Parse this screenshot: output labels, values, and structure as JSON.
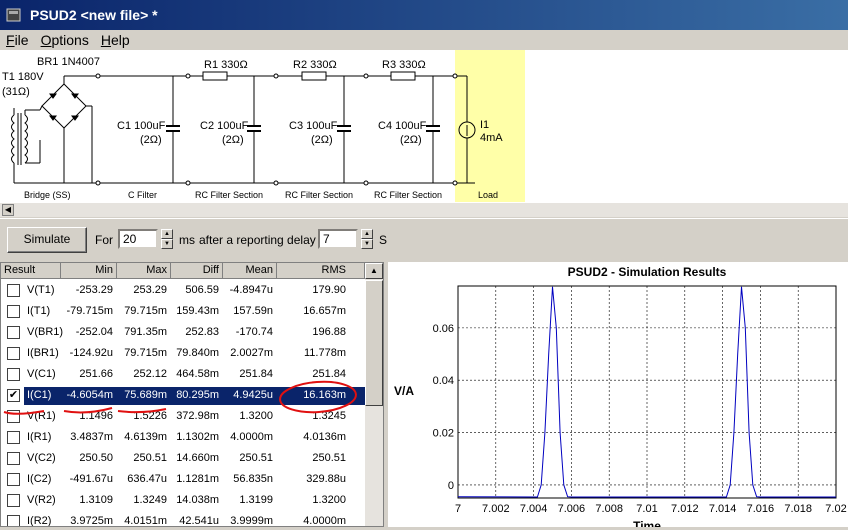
{
  "window": {
    "title": "PSUD2  <new file> *"
  },
  "menu": {
    "file": "F",
    "file_rest": "ile",
    "options": "O",
    "options_rest": "ptions",
    "help": "H",
    "help_rest": "elp"
  },
  "schematic": {
    "t1_label": "T1 180V",
    "t1_res": "(31Ω)",
    "br1_label": "BR1 1N4007",
    "c1_label": "C1 100uF",
    "c1_res": "(2Ω)",
    "c2_label": "C2 100uF",
    "c2_res": "(2Ω)",
    "c3_label": "C3 100uF",
    "c3_res": "(2Ω)",
    "c4_label": "C4 100uF",
    "c4_res": "(2Ω)",
    "r1_label": "R1 330Ω",
    "r2_label": "R2 330Ω",
    "r3_label": "R3 330Ω",
    "i1_label": "I1",
    "i1_value": "4mA",
    "sections": [
      "Bridge (SS)",
      "C Filter",
      "RC Filter Section",
      "RC Filter Section",
      "RC Filter Section",
      "Load"
    ]
  },
  "controls": {
    "simulate_label": "Simulate",
    "for_label": "For",
    "duration_value": "20",
    "ms_label": "ms",
    "delay_label": "after a reporting delay of",
    "delay_value": "7",
    "s_label": "S"
  },
  "results": {
    "headers": [
      "Result",
      "Min",
      "Max",
      "Diff",
      "Mean",
      "RMS"
    ],
    "rows": [
      {
        "name": "V(T1)",
        "min": "-253.29",
        "max": "253.29",
        "diff": "506.59",
        "mean": "-4.8947u",
        "rms": "179.90",
        "checked": false
      },
      {
        "name": "I(T1)",
        "min": "-79.715m",
        "max": "79.715m",
        "diff": "159.43m",
        "mean": "157.59n",
        "rms": "16.657m",
        "checked": false
      },
      {
        "name": "V(BR1)",
        "min": "-252.04",
        "max": "791.35m",
        "diff": "252.83",
        "mean": "-170.74",
        "rms": "196.88",
        "checked": false
      },
      {
        "name": "I(BR1)",
        "min": "-124.92u",
        "max": "79.715m",
        "diff": "79.840m",
        "mean": "2.0027m",
        "rms": "11.778m",
        "checked": false
      },
      {
        "name": "V(C1)",
        "min": "251.66",
        "max": "252.12",
        "diff": "464.58m",
        "mean": "251.84",
        "rms": "251.84",
        "checked": false
      },
      {
        "name": "I(C1)",
        "min": "-4.6054m",
        "max": "75.689m",
        "diff": "80.295m",
        "mean": "4.9425u",
        "rms": "16.163m",
        "checked": true
      },
      {
        "name": "V(R1)",
        "min": "1.1496",
        "max": "1.5226",
        "diff": "372.98m",
        "mean": "1.3200",
        "rms": "1.3245",
        "checked": false
      },
      {
        "name": "I(R1)",
        "min": "3.4837m",
        "max": "4.6139m",
        "diff": "1.1302m",
        "mean": "4.0000m",
        "rms": "4.0136m",
        "checked": false
      },
      {
        "name": "V(C2)",
        "min": "250.50",
        "max": "250.51",
        "diff": "14.660m",
        "mean": "250.51",
        "rms": "250.51",
        "checked": false
      },
      {
        "name": "I(C2)",
        "min": "-491.67u",
        "max": "636.47u",
        "diff": "1.1281m",
        "mean": "56.835n",
        "rms": "329.88u",
        "checked": false
      },
      {
        "name": "V(R2)",
        "min": "1.3109",
        "max": "1.3249",
        "diff": "14.038m",
        "mean": "1.3199",
        "rms": "1.3200",
        "checked": false
      },
      {
        "name": "I(R2)",
        "min": "3.9725m",
        "max": "4.0151m",
        "diff": "42.541u",
        "mean": "3.9999m",
        "rms": "4.0000m",
        "checked": false
      }
    ]
  },
  "chart_data": {
    "type": "line",
    "title": "PSUD2 - Simulation Results",
    "xlabel": "Time",
    "ylabel": "V/A",
    "xlim": [
      7,
      7.02
    ],
    "ylim": [
      -0.005,
      0.076
    ],
    "x_ticks": [
      "7",
      "7.002",
      "7.004",
      "7.006",
      "7.008",
      "7.01",
      "7.012",
      "7.014",
      "7.016",
      "7.018",
      "7.02"
    ],
    "y_ticks": [
      "0",
      "0.02",
      "0.04",
      "0.06"
    ],
    "grid": true,
    "series": [
      {
        "color": "#0000c0",
        "x": [
          7.0,
          7.0042,
          7.0044,
          7.0046,
          7.0048,
          7.005,
          7.0052,
          7.0054,
          7.0056,
          7.0058,
          7.006,
          7.0142,
          7.0144,
          7.0146,
          7.0148,
          7.015,
          7.0152,
          7.0154,
          7.0156,
          7.0158,
          7.016,
          7.02
        ],
        "y": [
          -0.0045,
          -0.0046,
          0.0,
          0.02,
          0.05,
          0.0757,
          0.06,
          0.02,
          0.0,
          -0.0045,
          -0.0046,
          -0.0046,
          0.0,
          0.02,
          0.05,
          0.0757,
          0.06,
          0.02,
          0.0,
          -0.0045,
          -0.0046,
          -0.0046
        ]
      }
    ]
  }
}
